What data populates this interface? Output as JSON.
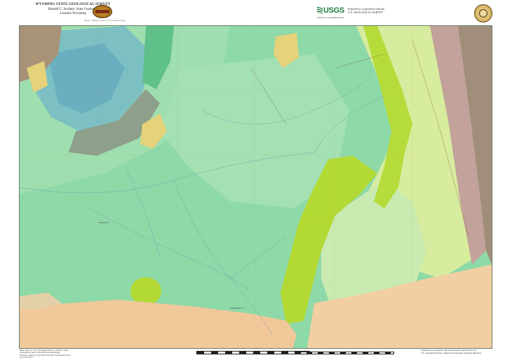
{
  "header": {
    "agency": "WYOMING STATE GEOLOGICAL SURVEY",
    "geologist": "Ronald C. Surdam, State Geologist",
    "location": "Laramie Wyoming",
    "partner_logo": "USGS",
    "partner_tagline": "science for a changing world",
    "cooperation_line1": "Prepared in cooperation with the",
    "cooperation_line2": "U.S. GEOLOGICAL SURVEY",
    "seal_caption": "Energy - Minerals Aspects of Wyoming Geology"
  },
  "map": {
    "colors": {
      "base_green": "#8ed9a8",
      "light_green": "#a8e3b2",
      "pale_green": "#c7edb5",
      "yellow_green": "#b6dc3c",
      "pale_yellow": "#dfeca6",
      "tan": "#f0c89a",
      "brown": "#9e8a72",
      "mauve": "#c2a29a",
      "blue": "#74b9c5",
      "gray_green": "#8ea08c",
      "gold": "#e6d27a"
    },
    "boundary_labels": [
      "Sublette Co",
      "Sweetwater Co"
    ]
  },
  "footer": {
    "credit_line1": "Base map from U.S. Geological Survey 1:24,000 - scale",
    "credit_line2": "topographic maps of the Wyoming quadrangle",
    "credit_line3": "Geology mapped by the Wyoming State Geological Survey",
    "note_line1": "Prepared in cooperation with and research supported by the",
    "note_line2": "U.S. Geological Survey, National Cooperative Geologic Mapping",
    "ids": "Open File Report"
  }
}
